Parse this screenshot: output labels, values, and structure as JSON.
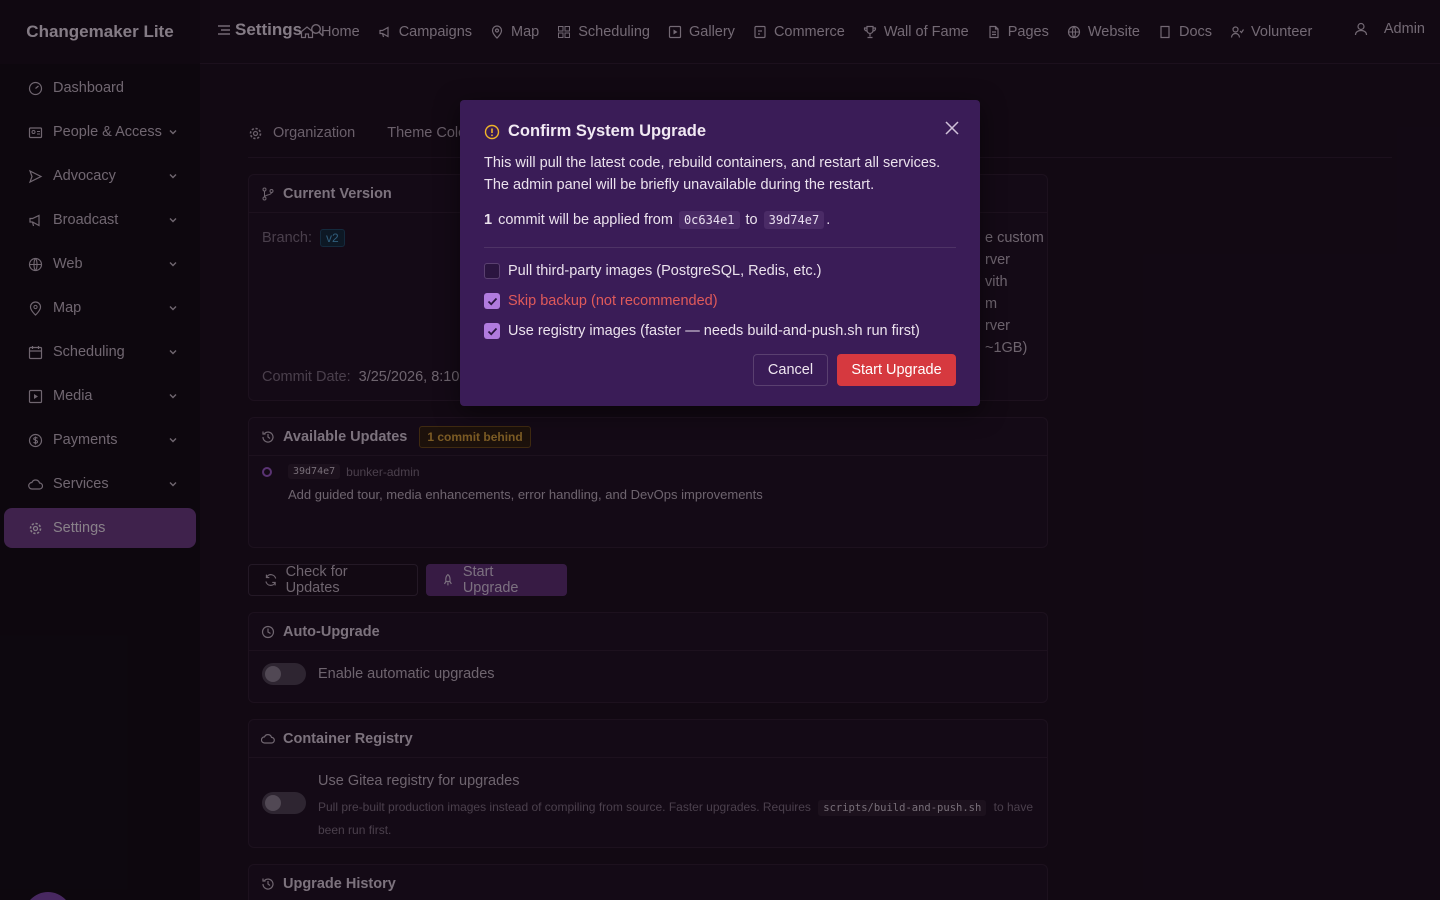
{
  "app": {
    "brand": "Changemaker Lite",
    "page_title": "Settings",
    "admin_label": "Admin"
  },
  "nav": {
    "items": [
      "Home",
      "Campaigns",
      "Map",
      "Scheduling",
      "Gallery",
      "Commerce",
      "Wall of Fame",
      "Pages",
      "Website",
      "Docs",
      "Volunteer"
    ],
    "icons": [
      "home-icon",
      "megaphone-icon",
      "map-pin-icon",
      "grid-icon",
      "play-square-icon",
      "commerce-icon",
      "trophy-icon",
      "page-icon",
      "globe-icon",
      "doc-icon",
      "volunteer-icon"
    ]
  },
  "sidebar": {
    "items": [
      {
        "label": "Dashboard",
        "icon": "dashboard-icon",
        "expandable": false
      },
      {
        "label": "People & Access",
        "icon": "id-card-icon",
        "expandable": true
      },
      {
        "label": "Advocacy",
        "icon": "send-icon",
        "expandable": true
      },
      {
        "label": "Broadcast",
        "icon": "megaphone-icon",
        "expandable": true
      },
      {
        "label": "Web",
        "icon": "globe-icon",
        "expandable": true
      },
      {
        "label": "Map",
        "icon": "map-pin-icon",
        "expandable": true
      },
      {
        "label": "Scheduling",
        "icon": "calendar-icon",
        "expandable": true
      },
      {
        "label": "Media",
        "icon": "play-square-icon",
        "expandable": true
      },
      {
        "label": "Payments",
        "icon": "dollar-icon",
        "expandable": true
      },
      {
        "label": "Services",
        "icon": "cloud-icon",
        "expandable": true
      },
      {
        "label": "Settings",
        "icon": "gear-icon",
        "expandable": false,
        "active": true
      }
    ]
  },
  "tabs": [
    "Organization",
    "Theme Colo"
  ],
  "current_version": {
    "title": "Current Version",
    "branch_label": "Branch:",
    "branch_value": "v2",
    "commit_date_label": "Commit Date:",
    "commit_date_value": "3/25/2026, 8:10:",
    "right_fragments": [
      "e custom",
      "rver",
      "vith",
      "m",
      "rver",
      "~1GB)"
    ]
  },
  "available_updates": {
    "title": "Available Updates",
    "badge": "1 commit behind",
    "commit_hash": "39d74e7",
    "commit_author": "bunker-admin",
    "commit_message": "Add guided tour, media enhancements, error handling, and DevOps improvements"
  },
  "actions": {
    "check_updates": "Check for Updates",
    "start_upgrade": "Start Upgrade"
  },
  "auto_upgrade": {
    "title": "Auto-Upgrade",
    "toggle_label": "Enable automatic upgrades",
    "enabled": false
  },
  "container_registry": {
    "title": "Container Registry",
    "toggle_label": "Use Gitea registry for upgrades",
    "desc_before": "Pull pre-built production images instead of compiling from source. Faster upgrades. Requires",
    "desc_code": "scripts/build-and-push.sh",
    "desc_after": "to have",
    "desc_line2": "been run first.",
    "enabled": false
  },
  "upgrade_history": {
    "title": "Upgrade History"
  },
  "modal": {
    "title": "Confirm System Upgrade",
    "description": "This will pull the latest code, rebuild containers, and restart all services. The admin panel will be briefly unavailable during the restart.",
    "commit_count": "1",
    "commit_text": "commit will be applied from",
    "from_hash": "0c634e1",
    "to_word": "to",
    "to_hash": "39d74e7",
    "period": ".",
    "options": [
      {
        "label": "Pull third-party images (PostgreSQL, Redis, etc.)",
        "checked": false
      },
      {
        "label": "Skip backup (not recommended)",
        "checked": true,
        "danger": true
      },
      {
        "label": "Use registry images (faster — needs build-and-push.sh run first)",
        "checked": true
      }
    ],
    "cancel": "Cancel",
    "confirm": "Start Upgrade"
  },
  "colors": {
    "accent": "#6a3b82",
    "danger": "#d6393f",
    "modal_bg": "#3a1c57",
    "warning": "#d8a23a"
  }
}
